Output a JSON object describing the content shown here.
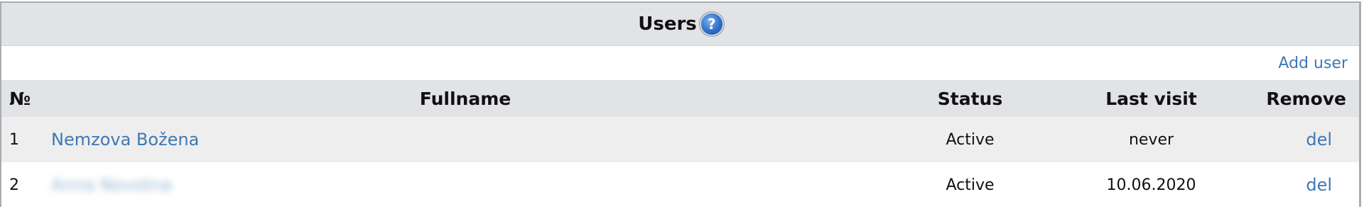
{
  "panel": {
    "title": "Users",
    "help_icon": "question-circle-icon",
    "add_user_label": "Add user"
  },
  "table": {
    "columns": [
      "№",
      "Fullname",
      "Status",
      "Last visit",
      "Remove"
    ],
    "rows": [
      {
        "num": "1",
        "fullname": "Nemzova Božena",
        "status": "Active",
        "last_visit": "never",
        "remove": "del"
      },
      {
        "num": "2",
        "fullname": "Anna Novotna",
        "status": "Active",
        "last_visit": "10.06.2020",
        "remove": "del"
      }
    ]
  },
  "colors": {
    "link": "#3f78b3",
    "header_bg": "#e1e3e6",
    "alt_row_bg": "#eeeeee",
    "arrow": "#e8111a"
  }
}
